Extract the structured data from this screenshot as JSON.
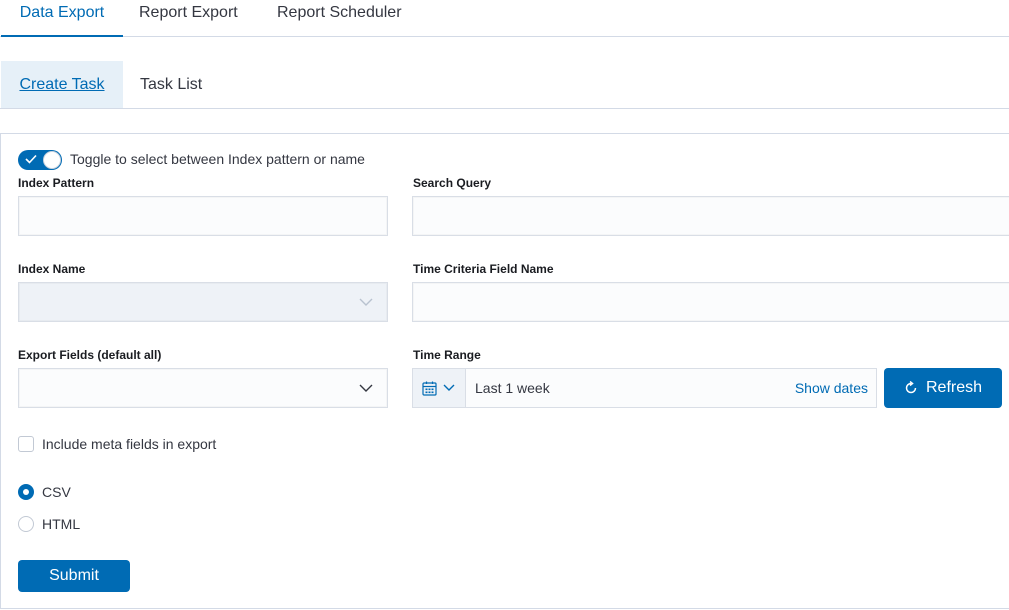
{
  "top_tabs": [
    "Data Export",
    "Report Export",
    "Report Scheduler"
  ],
  "sub_tabs": [
    "Create Task",
    "Task List"
  ],
  "form": {
    "toggle_label": "Toggle to select between Index pattern or name",
    "toggle_on": true,
    "index_pattern_label": "Index Pattern",
    "index_pattern_value": "",
    "search_query_label": "Search Query",
    "search_query_value": "",
    "index_name_label": "Index Name",
    "time_field_label": "Time Criteria Field Name",
    "time_field_value": "",
    "export_fields_label": "Export Fields (default all)",
    "time_range_label": "Time Range",
    "time_range_value": "Last 1 week",
    "show_dates": "Show dates",
    "refresh_label": "Refresh",
    "meta_fields_label": "Include meta fields in export",
    "formats": [
      {
        "label": "CSV",
        "selected": true
      },
      {
        "label": "HTML",
        "selected": false
      }
    ],
    "submit_label": "Submit"
  },
  "colors": {
    "accent": "#006bb4",
    "border": "#d3dae6",
    "subtab_bg": "#e6f0f8"
  },
  "icons": [
    "check-icon",
    "chevron-down-icon",
    "calendar-icon",
    "refresh-icon"
  ]
}
